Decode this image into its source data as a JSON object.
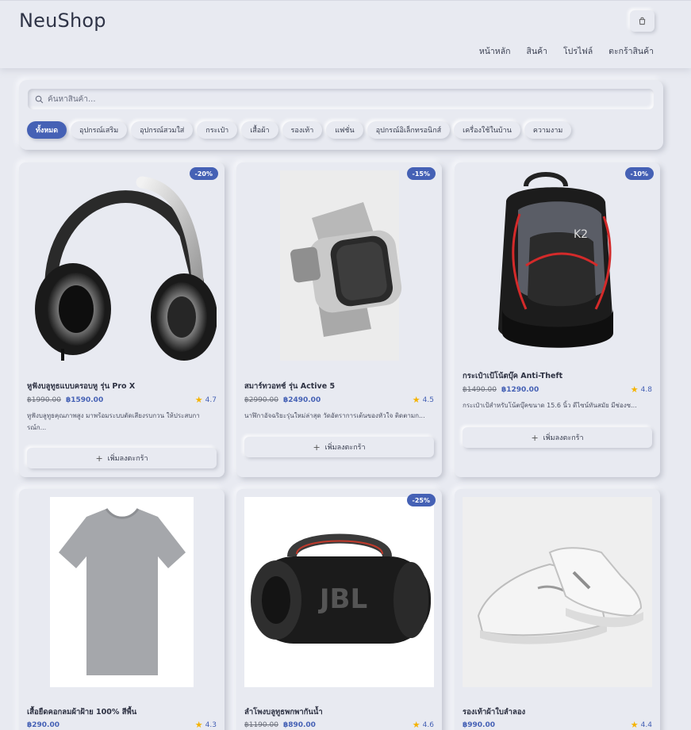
{
  "header": {
    "brand": "NeuShop",
    "nav": [
      "หน้าหลัก",
      "สินค้า",
      "โปรไฟล์",
      "ตะกร้าสินค้า"
    ]
  },
  "search": {
    "placeholder": "ค้นหาสินค้า..."
  },
  "categories": [
    "ทั้งหมด",
    "อุปกรณ์เสริม",
    "อุปกรณ์สวมใส่",
    "กระเป๋า",
    "เสื้อผ้า",
    "รองเท้า",
    "แฟชั่น",
    "อุปกรณ์อิเล็กทรอนิกส์",
    "เครื่องใช้ในบ้าน",
    "ความงาม"
  ],
  "active_category": "ทั้งหมด",
  "add_to_cart_label": "เพิ่มลงตะกร้า",
  "colors": {
    "accent": "#4561b5",
    "star": "#f5b301",
    "background": "#e8eaf1"
  },
  "products": [
    {
      "name": "หูฟังบลูทูธแบบครอบหู รุ่น Pro X",
      "old_price": "฿1990.00",
      "price": "฿1590.00",
      "rating": "4.7",
      "badge": "-20%",
      "description": "หูฟังบลูทูธคุณภาพสูง มาพร้อมระบบตัดเสียงรบกวน ให้ประสบการณ์ก...",
      "image": "headphones"
    },
    {
      "name": "สมาร์ทวอทช์ รุ่น Active 5",
      "old_price": "฿2990.00",
      "price": "฿2490.00",
      "rating": "4.5",
      "badge": "-15%",
      "description": "นาฬิกาอัจฉริยะรุ่นใหม่ล่าสุด วัดอัตราการเต้นของหัวใจ ติดตามก...",
      "image": "smartwatch"
    },
    {
      "name": "กระเป๋าเป้โน้ตบุ๊ค Anti-Theft",
      "old_price": "฿1490.00",
      "price": "฿1290.00",
      "rating": "4.8",
      "badge": "-10%",
      "description": "กระเป๋าเป้สำหรับโน้ตบุ๊คขนาด 15.6 นิ้ว ดีไซน์ทันสมัย มีช่องซ...",
      "image": "backpack"
    },
    {
      "name": "เสื้อยืดคอกลมผ้าฝ้าย 100% สีพื้น",
      "old_price": "",
      "price": "฿290.00",
      "rating": "4.3",
      "badge": "",
      "description": "",
      "image": "tshirt"
    },
    {
      "name": "ลำโพงบลูทูธพกพากันน้ำ",
      "old_price": "฿1190.00",
      "price": "฿890.00",
      "rating": "4.6",
      "badge": "-25%",
      "description": "",
      "image": "speaker"
    },
    {
      "name": "รองเท้าผ้าใบลำลอง",
      "old_price": "",
      "price": "฿990.00",
      "rating": "4.4",
      "badge": "",
      "description": "",
      "image": "sneakers"
    }
  ]
}
